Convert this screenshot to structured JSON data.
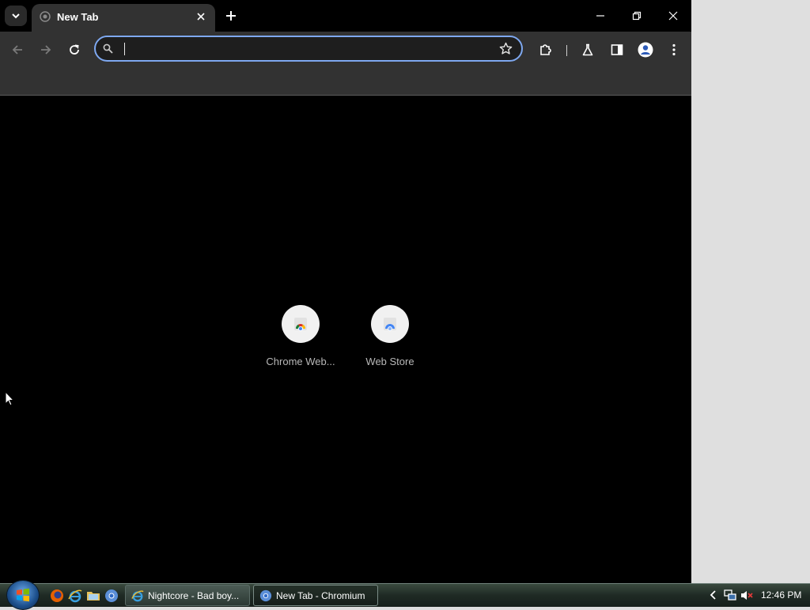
{
  "browser": {
    "tab": {
      "title": "New Tab"
    },
    "omnibox": {
      "value": "",
      "placeholder": ""
    },
    "shortcuts": [
      {
        "label": "Chrome Web...",
        "icon": "chrome-web-store-icon"
      },
      {
        "label": "Web Store",
        "icon": "web-store-icon"
      }
    ]
  },
  "taskbar": {
    "buttons": [
      {
        "label": "Nightcore - Bad boy...",
        "icon": "ie-icon"
      },
      {
        "label": "New Tab - Chromium",
        "icon": "chromium-icon"
      }
    ],
    "clock": "12:46 PM"
  },
  "colors": {
    "focus_ring": "#7ea8f0",
    "tab_active": "#323232",
    "page_bg": "#000000"
  }
}
